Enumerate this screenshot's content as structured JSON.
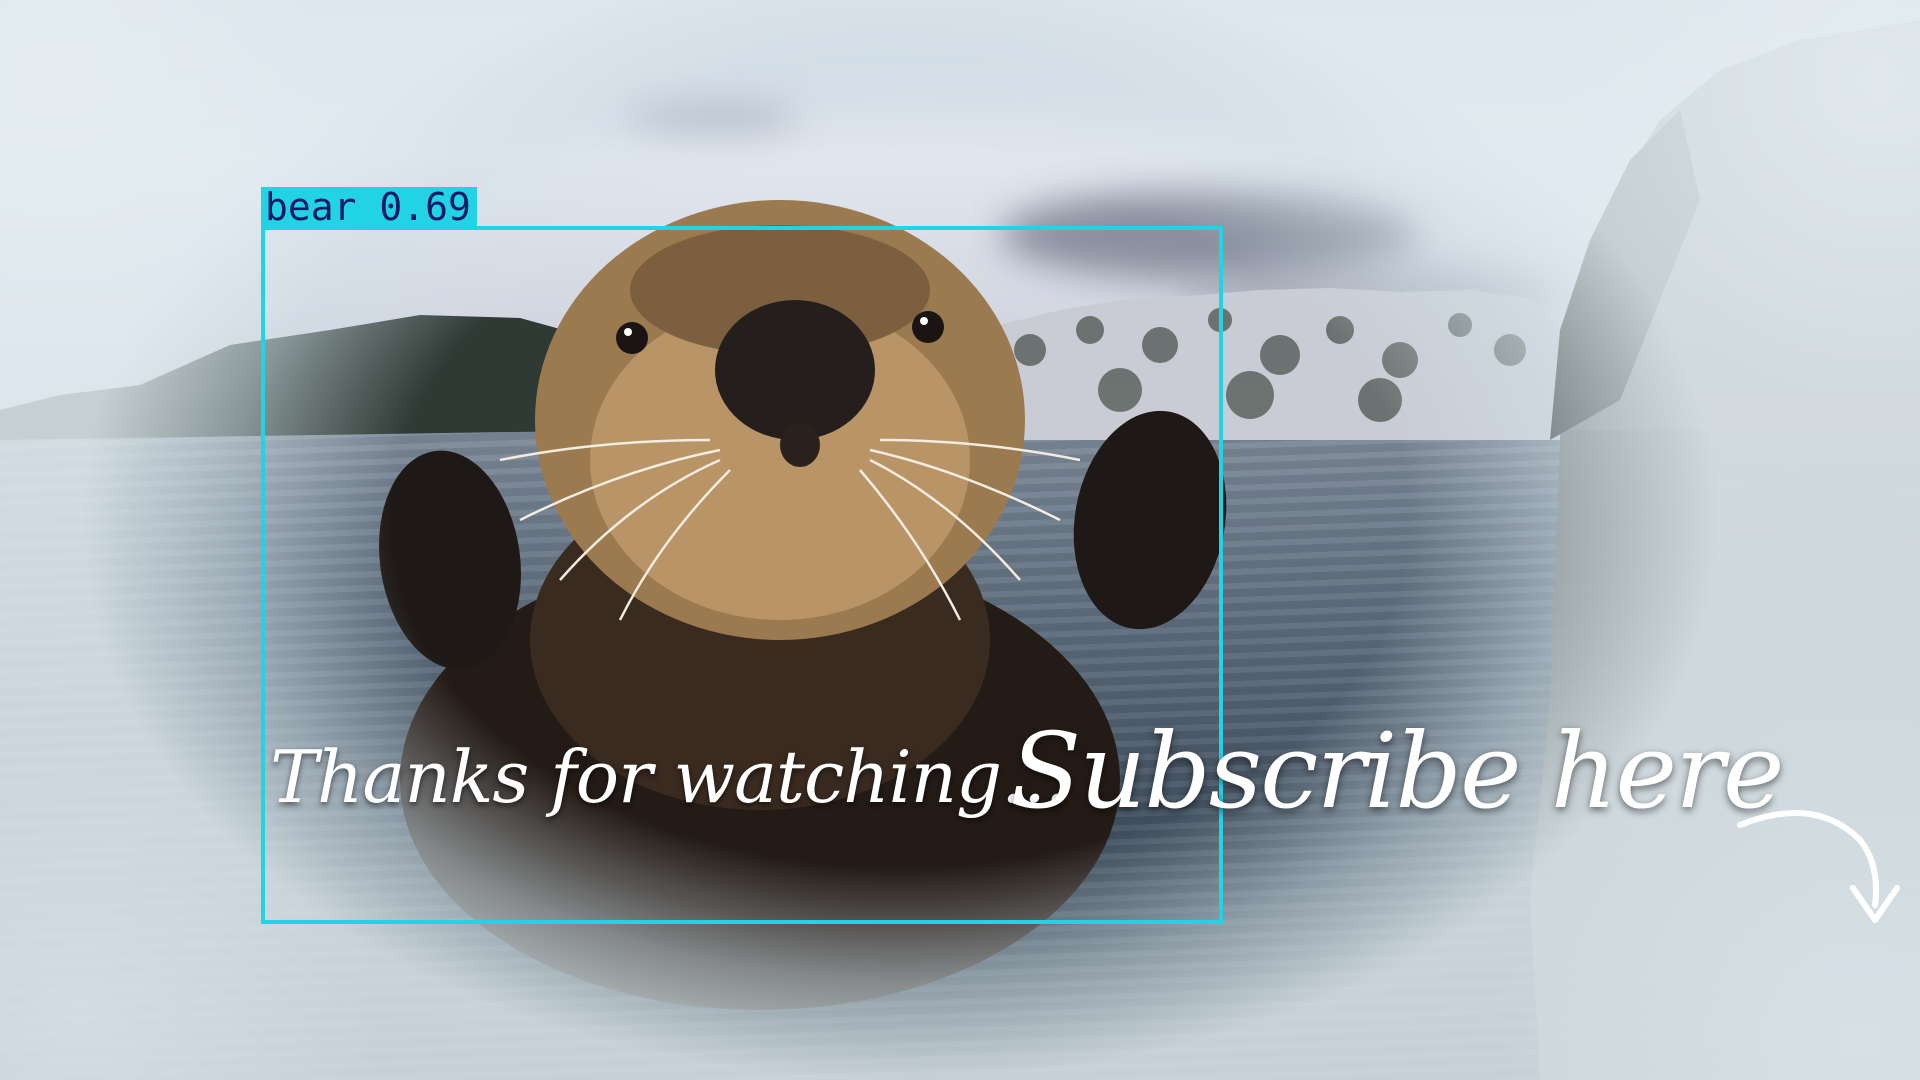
{
  "detection": {
    "label": "bear 0.69",
    "color": "#22d3e6",
    "label_text_color": "#111a66"
  },
  "end_screen": {
    "thanks_text": "Thanks for watching...",
    "subscribe_text": "Subscribe here",
    "arrow_icon": "curved-arrow-down-icon"
  },
  "scene": {
    "subject": "sea-otter",
    "text_color": "#ffffff"
  }
}
